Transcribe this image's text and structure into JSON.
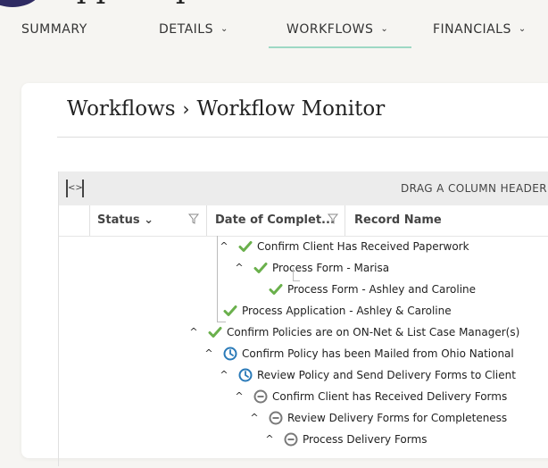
{
  "nav": {
    "tabs": [
      {
        "label": "SUMMARY",
        "dropdown": false,
        "active": false
      },
      {
        "label": "DETAILS",
        "dropdown": true,
        "active": false
      },
      {
        "label": "WORKFLOWS",
        "dropdown": true,
        "active": true
      },
      {
        "label": "FINANCIALS",
        "dropdown": true,
        "active": false
      }
    ]
  },
  "breadcrumb": {
    "root": "Workflows",
    "separator": "›",
    "current": "Workflow Monitor"
  },
  "grid": {
    "drag_hint": "DRAG A COLUMN HEADER",
    "columns": [
      {
        "label": "Status",
        "sort": "⌄"
      },
      {
        "label": "Date of Complet..."
      },
      {
        "label": "Record Name"
      }
    ],
    "rows": [
      {
        "label": "Confirm Client Has Received Paperwork",
        "status": "complete",
        "depth": 3,
        "toggle": "^"
      },
      {
        "label": "Process Form - Marisa",
        "status": "complete",
        "depth": 4,
        "toggle": "^"
      },
      {
        "label": "Process Form - Ashley and Caroline",
        "status": "complete",
        "depth": 5,
        "toggle": ""
      },
      {
        "label": "Process Application - Ashley & Caroline",
        "status": "complete",
        "depth": 2,
        "toggle": ""
      },
      {
        "label": "Confirm Policies are on ON-Net & List Case Manager(s)",
        "status": "complete",
        "depth": 1,
        "toggle": "^"
      },
      {
        "label": "Confirm Policy has been Mailed from Ohio National",
        "status": "pending",
        "depth": 2,
        "toggle": "^"
      },
      {
        "label": "Review Policy and Send Delivery Forms to Client",
        "status": "pending",
        "depth": 3,
        "toggle": "^"
      },
      {
        "label": "Confirm Client has Received Delivery Forms",
        "status": "blocked",
        "depth": 4,
        "toggle": "^"
      },
      {
        "label": "Review Delivery Forms for Completeness",
        "status": "blocked",
        "depth": 5,
        "toggle": "^"
      },
      {
        "label": "Process Delivery Forms",
        "status": "blocked",
        "depth": 6,
        "toggle": "^"
      }
    ]
  },
  "colors": {
    "complete": "#6ab04c",
    "pending": "#2a7ab8",
    "blocked": "#7a7a7a",
    "tab_underline": "#9ed8c4",
    "logo": "#2f2b63"
  },
  "icons": {
    "complete": "check-icon",
    "pending": "clock-icon",
    "blocked": "minus-circle-icon",
    "filter": "filter-icon",
    "collapse": "collapse-rows-icon"
  }
}
